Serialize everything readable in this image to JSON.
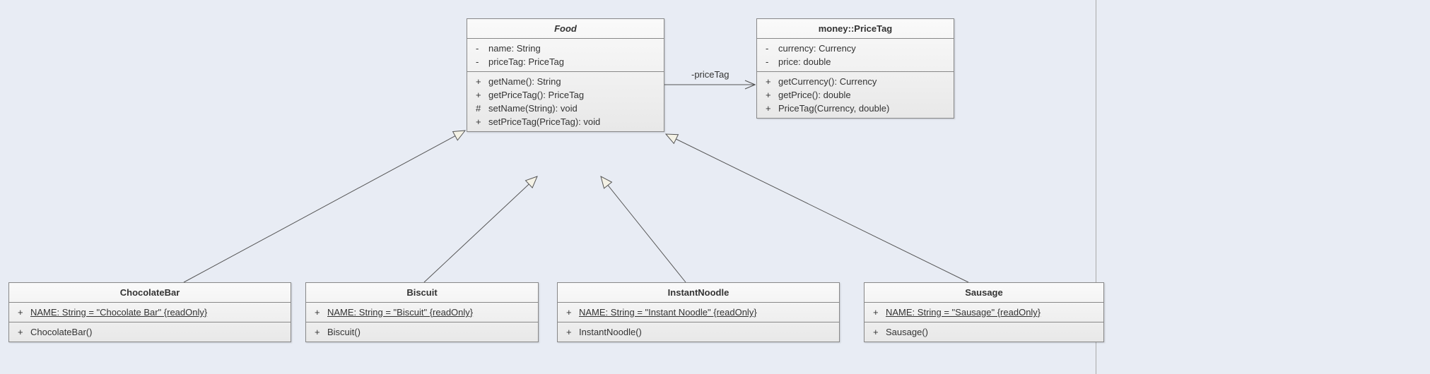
{
  "classes": {
    "food": {
      "name": "Food",
      "abstract": true,
      "attributes": [
        {
          "vis": "-",
          "text": "name: String"
        },
        {
          "vis": "-",
          "text": "priceTag: PriceTag"
        }
      ],
      "operations": [
        {
          "vis": "+",
          "text": "getName(): String"
        },
        {
          "vis": "+",
          "text": "getPriceTag(): PriceTag"
        },
        {
          "vis": "#",
          "text": "setName(String): void"
        },
        {
          "vis": "+",
          "text": "setPriceTag(PriceTag): void"
        }
      ]
    },
    "priceTag": {
      "name": "money::PriceTag",
      "attributes": [
        {
          "vis": "-",
          "text": "currency: Currency"
        },
        {
          "vis": "-",
          "text": "price: double"
        }
      ],
      "operations": [
        {
          "vis": "+",
          "text": "getCurrency(): Currency"
        },
        {
          "vis": "+",
          "text": "getPrice(): double"
        },
        {
          "vis": "+",
          "text": "PriceTag(Currency, double)"
        }
      ]
    },
    "chocolateBar": {
      "name": "ChocolateBar",
      "attributes": [
        {
          "vis": "+",
          "text": "NAME: String = \"Chocolate Bar\" {readOnly}",
          "static": true
        }
      ],
      "operations": [
        {
          "vis": "+",
          "text": "ChocolateBar()"
        }
      ]
    },
    "biscuit": {
      "name": "Biscuit",
      "attributes": [
        {
          "vis": "+",
          "text": "NAME: String = \"Biscuit\" {readOnly}",
          "static": true
        }
      ],
      "operations": [
        {
          "vis": "+",
          "text": "Biscuit()"
        }
      ]
    },
    "instantNoodle": {
      "name": "InstantNoodle",
      "attributes": [
        {
          "vis": "+",
          "text": "NAME: String = \"Instant Noodle\" {readOnly}",
          "static": true
        }
      ],
      "operations": [
        {
          "vis": "+",
          "text": "InstantNoodle()"
        }
      ]
    },
    "sausage": {
      "name": "Sausage",
      "attributes": [
        {
          "vis": "+",
          "text": "NAME: String = \"Sausage\" {readOnly}",
          "static": true
        }
      ],
      "operations": [
        {
          "vis": "+",
          "text": "Sausage()"
        }
      ]
    }
  },
  "association": {
    "label": "-priceTag"
  }
}
